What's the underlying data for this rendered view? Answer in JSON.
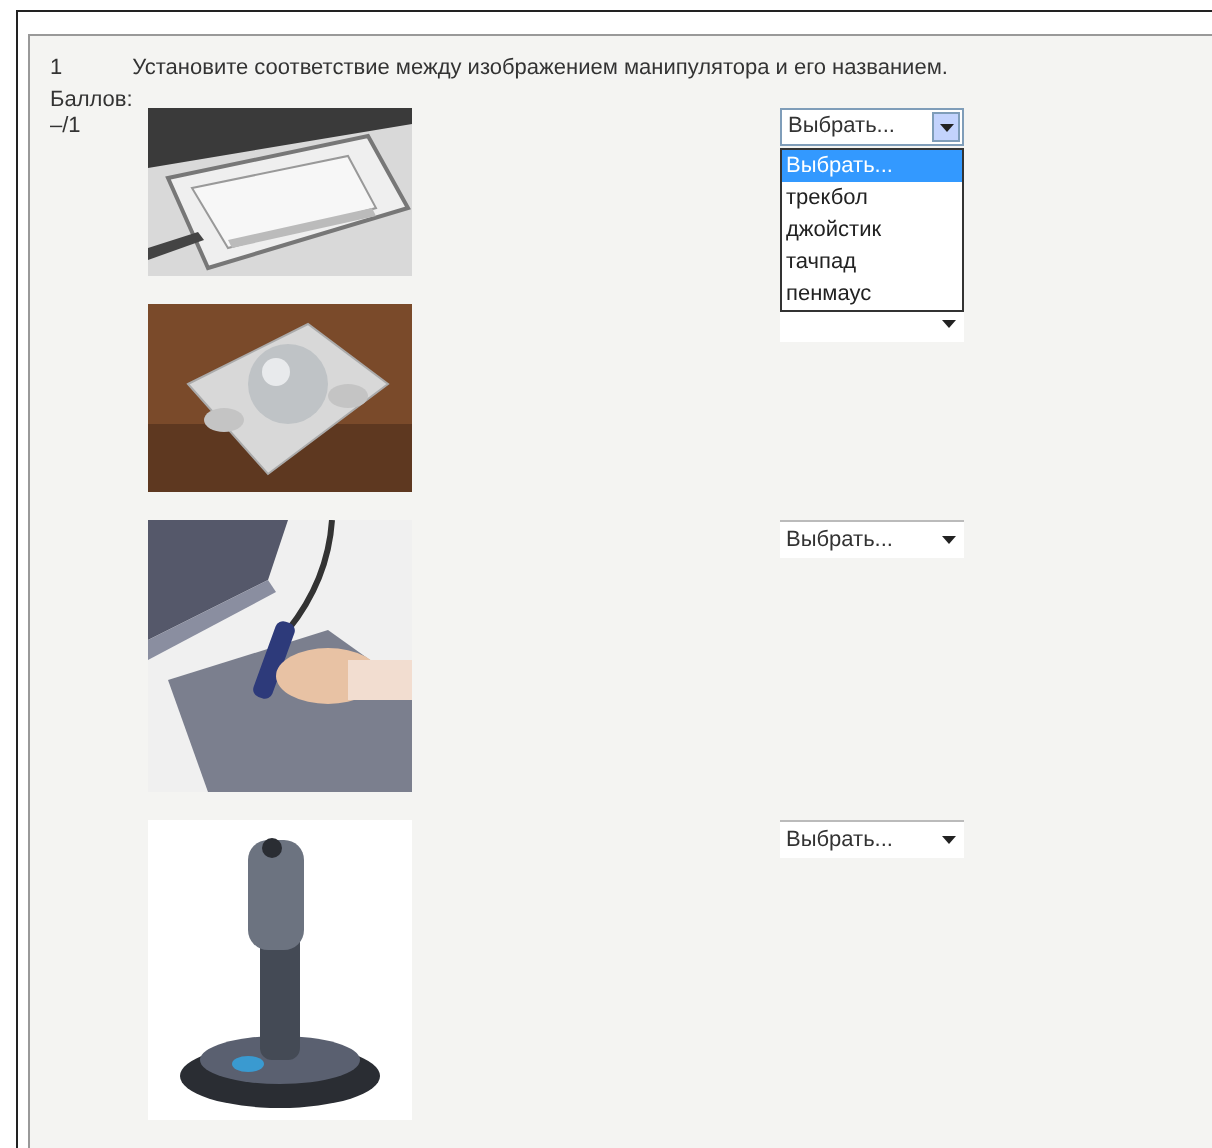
{
  "question": {
    "number": "1",
    "text": "Установите соответствие между изображением манипулятора и его названием.",
    "score_label": "Баллов:",
    "score": "–/1"
  },
  "items": [
    {
      "kind": "touchpad",
      "select": {
        "value": "Выбрать...",
        "open": true
      }
    },
    {
      "kind": "trackball",
      "select": {
        "open": false
      }
    },
    {
      "kind": "tablet",
      "select": {
        "value": "Выбрать...",
        "open": false
      }
    },
    {
      "kind": "joystick",
      "select": {
        "value": "Выбрать...",
        "open": false
      }
    }
  ],
  "dropdown_options": [
    {
      "label": "Выбрать...",
      "selected": true
    },
    {
      "label": "трекбол",
      "selected": false
    },
    {
      "label": "джойстик",
      "selected": false
    },
    {
      "label": "тачпад",
      "selected": false
    },
    {
      "label": "пенмаус",
      "selected": false
    }
  ]
}
